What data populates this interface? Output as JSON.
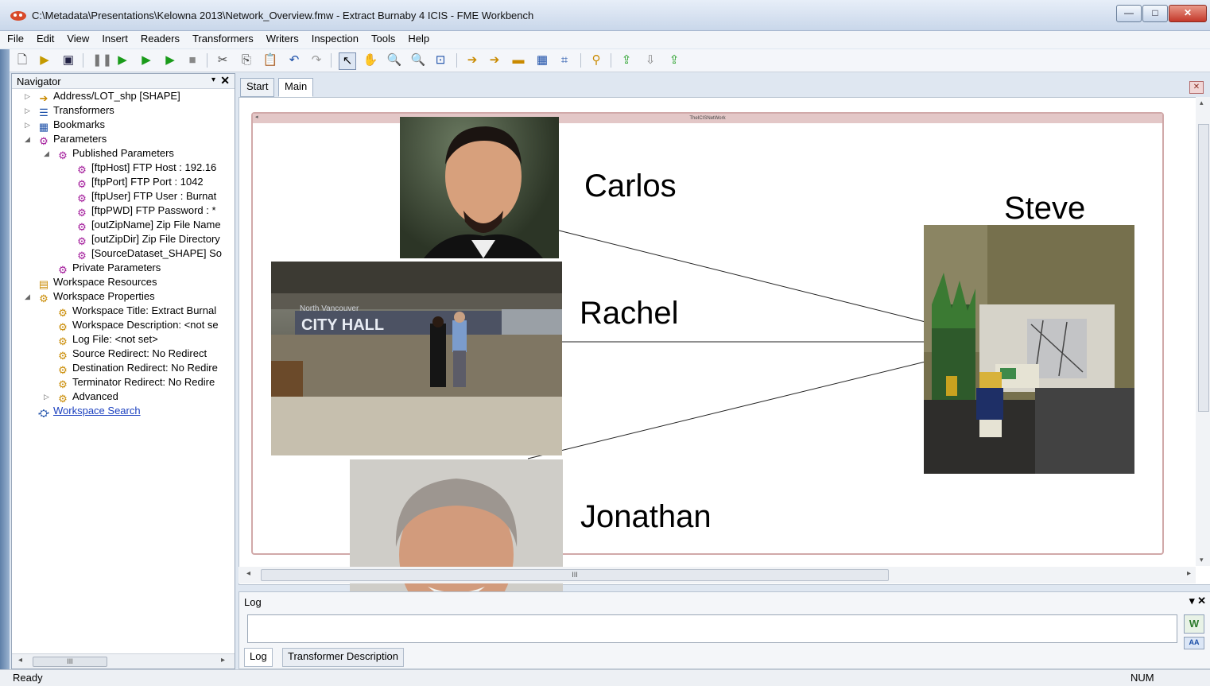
{
  "window": {
    "title": "C:\\Metadata\\Presentations\\Kelowna 2013\\Network_Overview.fmw - Extract Burnaby 4 ICIS - FME Workbench",
    "minimize": "—",
    "maximize": "□",
    "close": "✕"
  },
  "menu": [
    "File",
    "Edit",
    "View",
    "Insert",
    "Readers",
    "Transformers",
    "Writers",
    "Inspection",
    "Tools",
    "Help"
  ],
  "navigator": {
    "title": "Navigator",
    "close": "✕",
    "items": [
      "Address/LOT_shp [SHAPE]",
      "Transformers",
      "Bookmarks",
      "Parameters",
      "Published Parameters",
      "[ftpHost] FTP Host : 192.16",
      "[ftpPort] FTP Port : 1042",
      "[ftpUser] FTP User : Burnat",
      "[ftpPWD] FTP Password : *",
      "[outZipName] Zip File Name",
      "[outZipDir] Zip File Directory",
      "[SourceDataset_SHAPE] So",
      "Private Parameters",
      "Workspace Resources",
      "Workspace Properties",
      "Workspace Title: Extract Burnal",
      "Workspace Description: <not se",
      "Log File: <not set>",
      "Source Redirect: No Redirect",
      "Destination Redirect: No Redire",
      "Terminator Redirect: No Redire",
      "Advanced",
      "Workspace Search"
    ]
  },
  "tabs": [
    "Start",
    "Main"
  ],
  "bookmark": {
    "title": "TheICISNetWork"
  },
  "people": [
    "Carlos",
    "Rachel",
    "Steve",
    "Jonathan"
  ],
  "photo_text": {
    "city_hall": "CITY HALL",
    "north_van": "North Vancouver"
  },
  "log": {
    "title": "Log",
    "tabs": [
      "Log",
      "Transformer Description"
    ]
  },
  "status": {
    "ready": "Ready",
    "num": "NUM"
  },
  "scroll": {
    "grip": "III"
  }
}
